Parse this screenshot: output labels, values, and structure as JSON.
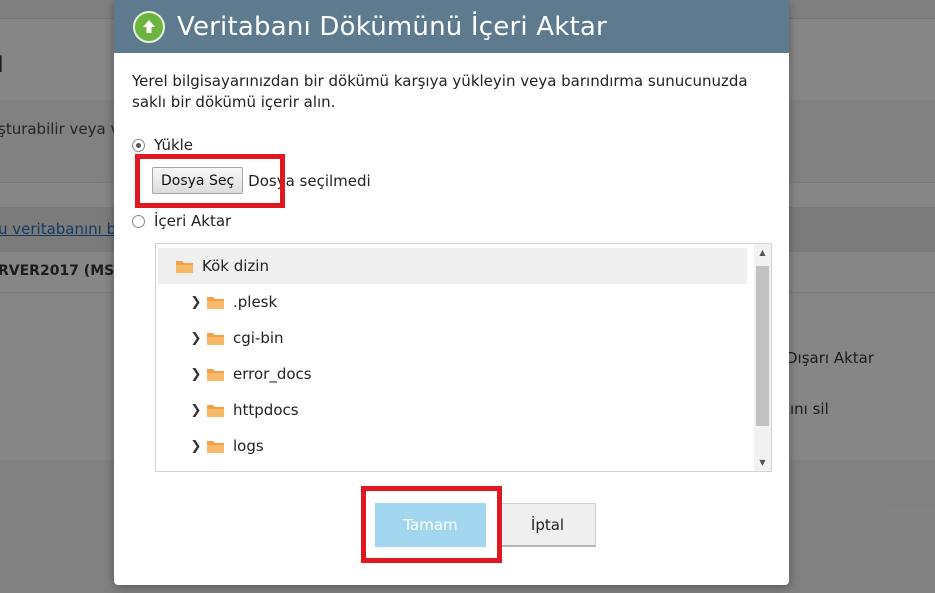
{
  "background": {
    "heading_fragment": "ı",
    "description_fragment": "şturabilir veya v",
    "link_fragment": "u veritabanını b",
    "server_fragment": "RVER2017 (MS S",
    "action_export_fragment": "Dışarı Aktar",
    "action_delete_fragment": "ını sil"
  },
  "dialog": {
    "title": "Veritabanı Dökümünü İçeri Aktar",
    "header_icon": "upload-arrow-icon",
    "header_color": "#5e7a8f",
    "intro_text": "Yerel bilgisayarınızdan bir dökümü karşıya yükleyin veya barındırma sunucunuzda saklı bir dökümü içerir alın.",
    "options": {
      "upload_label": "Yükle",
      "upload_selected": true,
      "import_label": "İçeri Aktar",
      "import_selected": false
    },
    "file_input": {
      "button_label": "Dosya Seç",
      "status": "Dosya seçilmedi"
    },
    "tree": {
      "root_label": "Kök dizin",
      "items": [
        {
          "label": ".plesk"
        },
        {
          "label": "cgi-bin"
        },
        {
          "label": "error_docs"
        },
        {
          "label": "httpdocs"
        },
        {
          "label": "logs"
        }
      ]
    },
    "buttons": {
      "ok_label": "Tamam",
      "cancel_label": "İptal"
    }
  },
  "highlight_color": "#e01820"
}
